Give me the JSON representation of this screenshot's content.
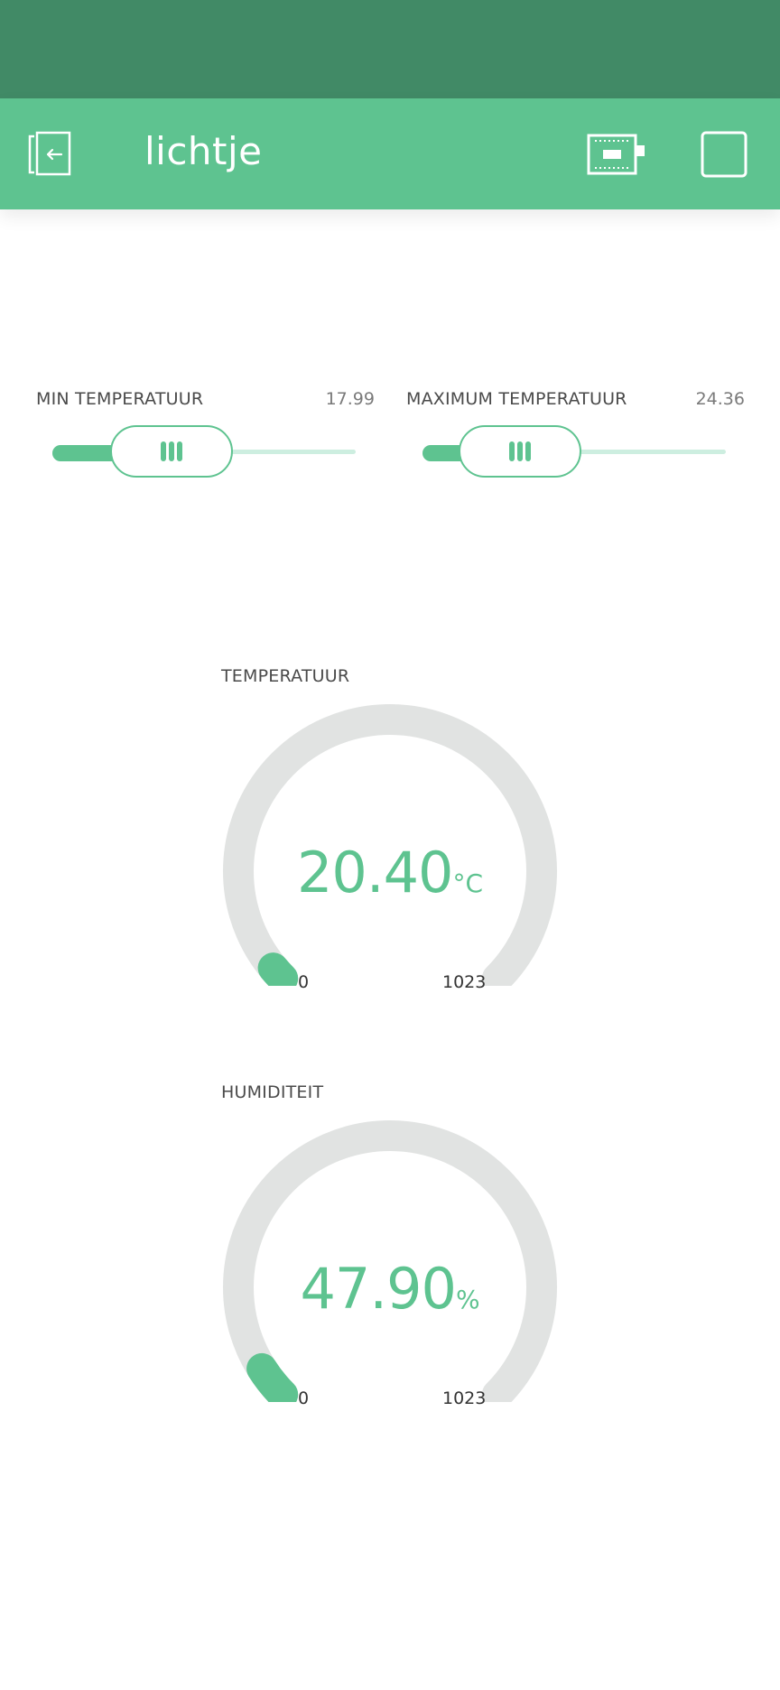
{
  "app": {
    "title": "lichtje"
  },
  "colors": {
    "status_bar": "#418a66",
    "accent": "#5ec390",
    "track": "#e1e3e2",
    "slider_track": "#cdeee0"
  },
  "icons": {
    "back": "exit-arrow-icon",
    "device": "device-board-icon",
    "square": "square-outline-icon",
    "grip": "slider-grip-icon"
  },
  "sliders": [
    {
      "label": "MIN TEMPERATUUR",
      "value": "17.99",
      "level": 0.18
    },
    {
      "label": "MAXIMUM TEMPERATUUR",
      "value": "24.36",
      "level": 0.12
    }
  ],
  "gauges": [
    {
      "label": "TEMPERATUUR",
      "value": "20.40",
      "unit": "°C",
      "min": "0",
      "max": "1023",
      "level": 0.0199
    },
    {
      "label": "HUMIDITEIT",
      "value": "47.90",
      "unit": "%",
      "min": "0",
      "max": "1023",
      "level": 0.0468
    }
  ]
}
